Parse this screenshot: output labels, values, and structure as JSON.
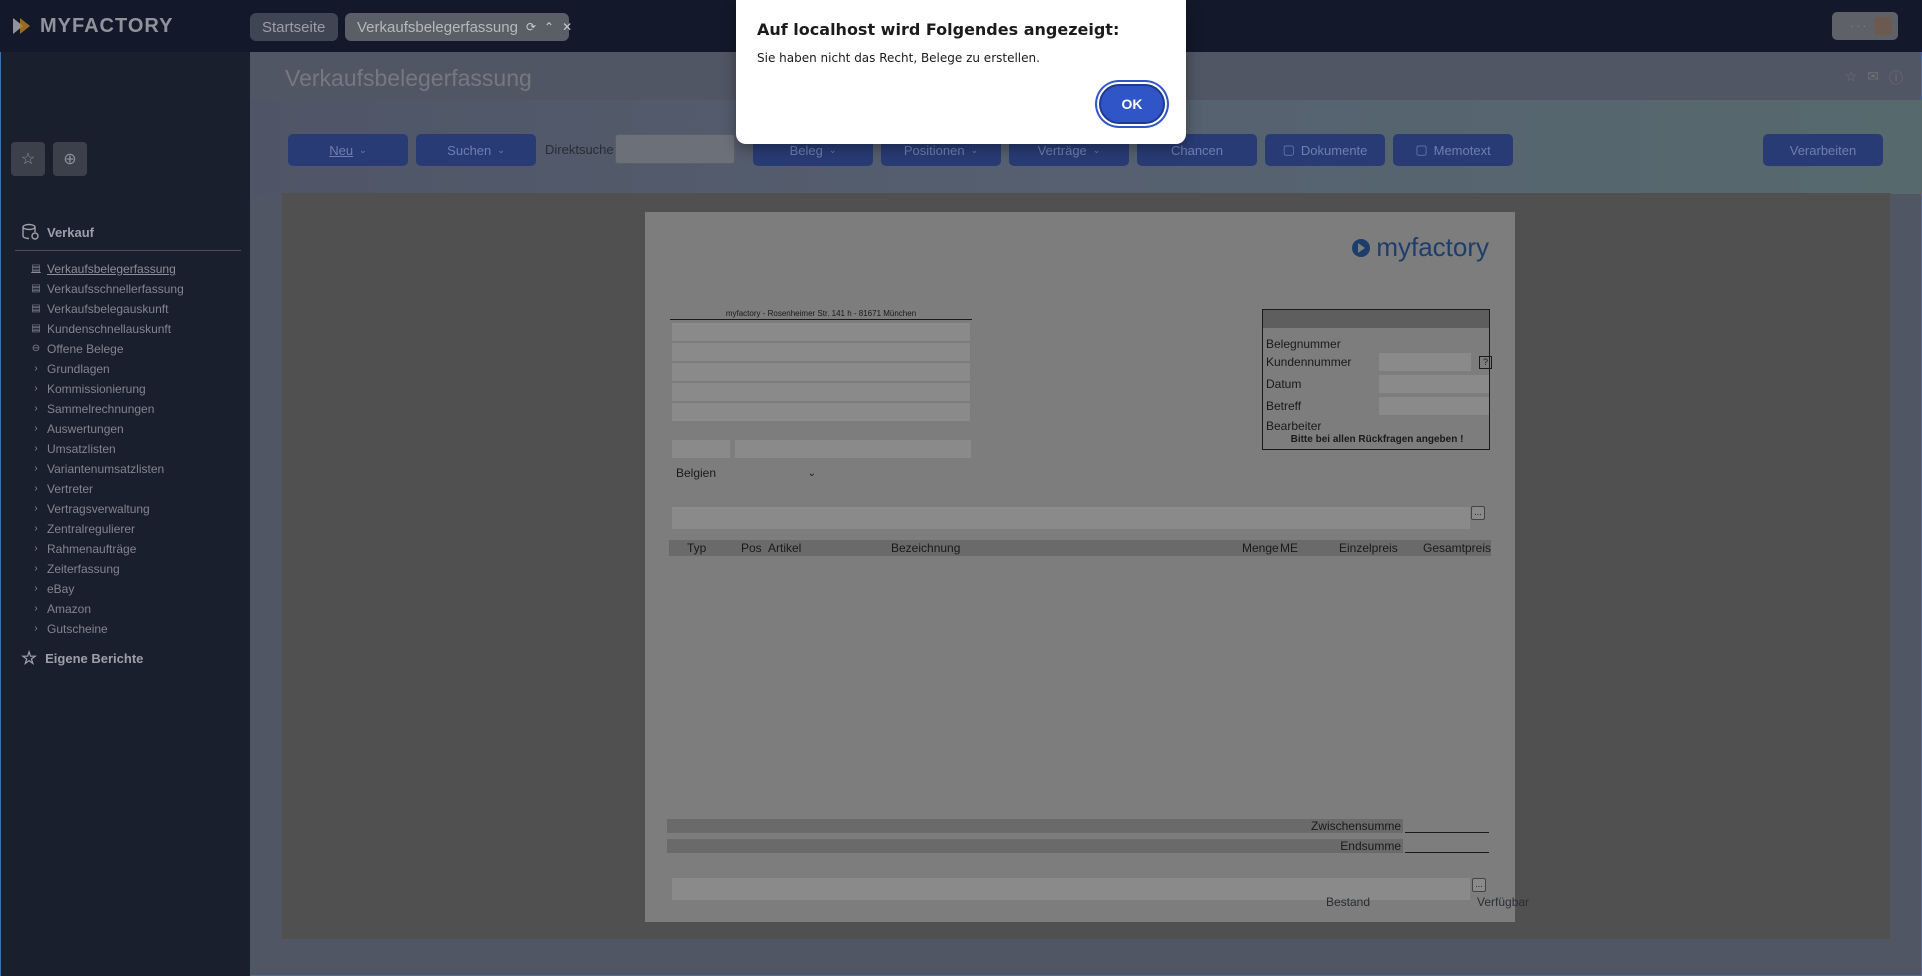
{
  "app": {
    "logo_text": "MYFACTORY",
    "tabs": [
      {
        "label": "Startseite"
      },
      {
        "label": "Verkaufsbelegerfassung"
      }
    ],
    "user_dots": "· · ·"
  },
  "sidebar": {
    "section_verkauf": "Verkauf",
    "items": [
      {
        "label": "Verkaufsbelegerfassung",
        "icon": "table-icon"
      },
      {
        "label": "Verkaufsschnellerfassung",
        "icon": "table-icon"
      },
      {
        "label": "Verkaufsbelegauskunft",
        "icon": "table-icon"
      },
      {
        "label": "Kundenschnellauskunft",
        "icon": "table-icon"
      },
      {
        "label": "Offene Belege",
        "icon": "lock-icon"
      },
      {
        "label": "Grundlagen",
        "icon": "chevron-right-icon"
      },
      {
        "label": "Kommissionierung",
        "icon": "chevron-right-icon"
      },
      {
        "label": "Sammelrechnungen",
        "icon": "chevron-right-icon"
      },
      {
        "label": "Auswertungen",
        "icon": "chevron-right-icon"
      },
      {
        "label": "Umsatzlisten",
        "icon": "chevron-right-icon"
      },
      {
        "label": "Variantenumsatzlisten",
        "icon": "chevron-right-icon"
      },
      {
        "label": "Vertreter",
        "icon": "chevron-right-icon"
      },
      {
        "label": "Vertragsverwaltung",
        "icon": "chevron-right-icon"
      },
      {
        "label": "Zentralregulierer",
        "icon": "chevron-right-icon"
      },
      {
        "label": "Rahmenaufträge",
        "icon": "chevron-right-icon"
      },
      {
        "label": "Zeiterfassung",
        "icon": "chevron-right-icon"
      },
      {
        "label": "eBay",
        "icon": "chevron-right-icon"
      },
      {
        "label": "Amazon",
        "icon": "chevron-right-icon"
      },
      {
        "label": "Gutscheine",
        "icon": "chevron-right-icon"
      }
    ],
    "section_eigene": "Eigene Berichte"
  },
  "main": {
    "title": "Verkaufsbelegerfassung",
    "toolbar": {
      "neu": "Neu",
      "suchen": "Suchen",
      "direktsuche_label": "Direktsuche:",
      "beleg": "Beleg",
      "positionen": "Positionen",
      "vertraege": "Verträge",
      "chancen": "Chancen",
      "dokumente": "Dokumente",
      "memotext": "Memotext",
      "verarbeiten": "Verarbeiten"
    },
    "document": {
      "logo": "myfactory",
      "sender": "myfactory - Rosenheimer Str. 141 h - 81671 München",
      "country": "Belgien",
      "info": {
        "belegnummer": "Belegnummer",
        "kundennummer": "Kundennummer",
        "datum": "Datum",
        "betreff": "Betreff",
        "bearbeiter": "Bearbeiter",
        "note": "Bitte bei allen Rückfragen angeben !"
      },
      "columns": {
        "typ": "Typ",
        "pos": "Pos",
        "artikel": "Artikel",
        "bezeichnung": "Bezeichnung",
        "menge": "Menge",
        "me": "ME",
        "einzelpreis": "Einzelpreis",
        "gesamtpreis": "Gesamtpreis"
      },
      "zwischensumme": "Zwischensumme",
      "endsumme": "Endsumme",
      "dots": "..."
    },
    "footer": {
      "bestand": "Bestand",
      "verfuegbar": "Verfügbar"
    }
  },
  "dialog": {
    "title": "Auf localhost wird Folgendes angezeigt:",
    "message": "Sie haben nicht das Recht, Belege zu erstellen.",
    "ok": "OK"
  }
}
